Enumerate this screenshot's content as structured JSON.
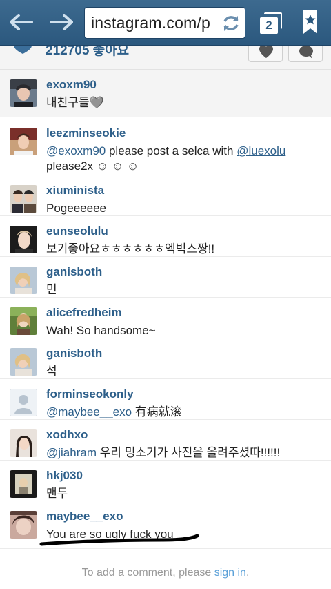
{
  "browser": {
    "url": "instagram.com/p",
    "tab_count": "2",
    "icons": [
      "back-arrow-icon",
      "forward-arrow-icon",
      "reload-icon",
      "tabs-icon",
      "bookmark-icon"
    ]
  },
  "post": {
    "likes": "212705 좋아요"
  },
  "caption": {
    "username": "exoxm90",
    "text": "내친구들🩶"
  },
  "comments": [
    {
      "username": "leezminseokie",
      "mention1": "@exoxm90",
      "text_mid": " please post a selca with ",
      "mention2": "@luexolu",
      "text_end": "please2x ☺ ☺ ☺"
    },
    {
      "username": "xiuminista",
      "text": "Pogeeeeee"
    },
    {
      "username": "eunseolulu",
      "text": "보기좋아요ㅎㅎㅎㅎㅎㅎ엑빅스짱!!"
    },
    {
      "username": "ganisboth",
      "text": "민"
    },
    {
      "username": "alicefredheim",
      "text": "Wah! So handsome~"
    },
    {
      "username": "ganisboth",
      "text": "석"
    },
    {
      "username": "forminseokonly",
      "mention": "@maybee__exo",
      "text": " 有病就滚"
    },
    {
      "username": "xodhxo",
      "mention": "@jiahram",
      "text": " 우리 밍소기가 사진을 올려주셨따!!!!!!"
    },
    {
      "username": "hkj030",
      "text": "맨두"
    },
    {
      "username": "maybee__exo",
      "text": "You are so ugly fuck you"
    }
  ],
  "footer": {
    "prefix": "To add a comment, please ",
    "link": "sign in",
    "suffix": "."
  },
  "colors": {
    "toolbar": "#2b587e",
    "username": "#2d5f8a",
    "link": "#5aa0d8"
  }
}
